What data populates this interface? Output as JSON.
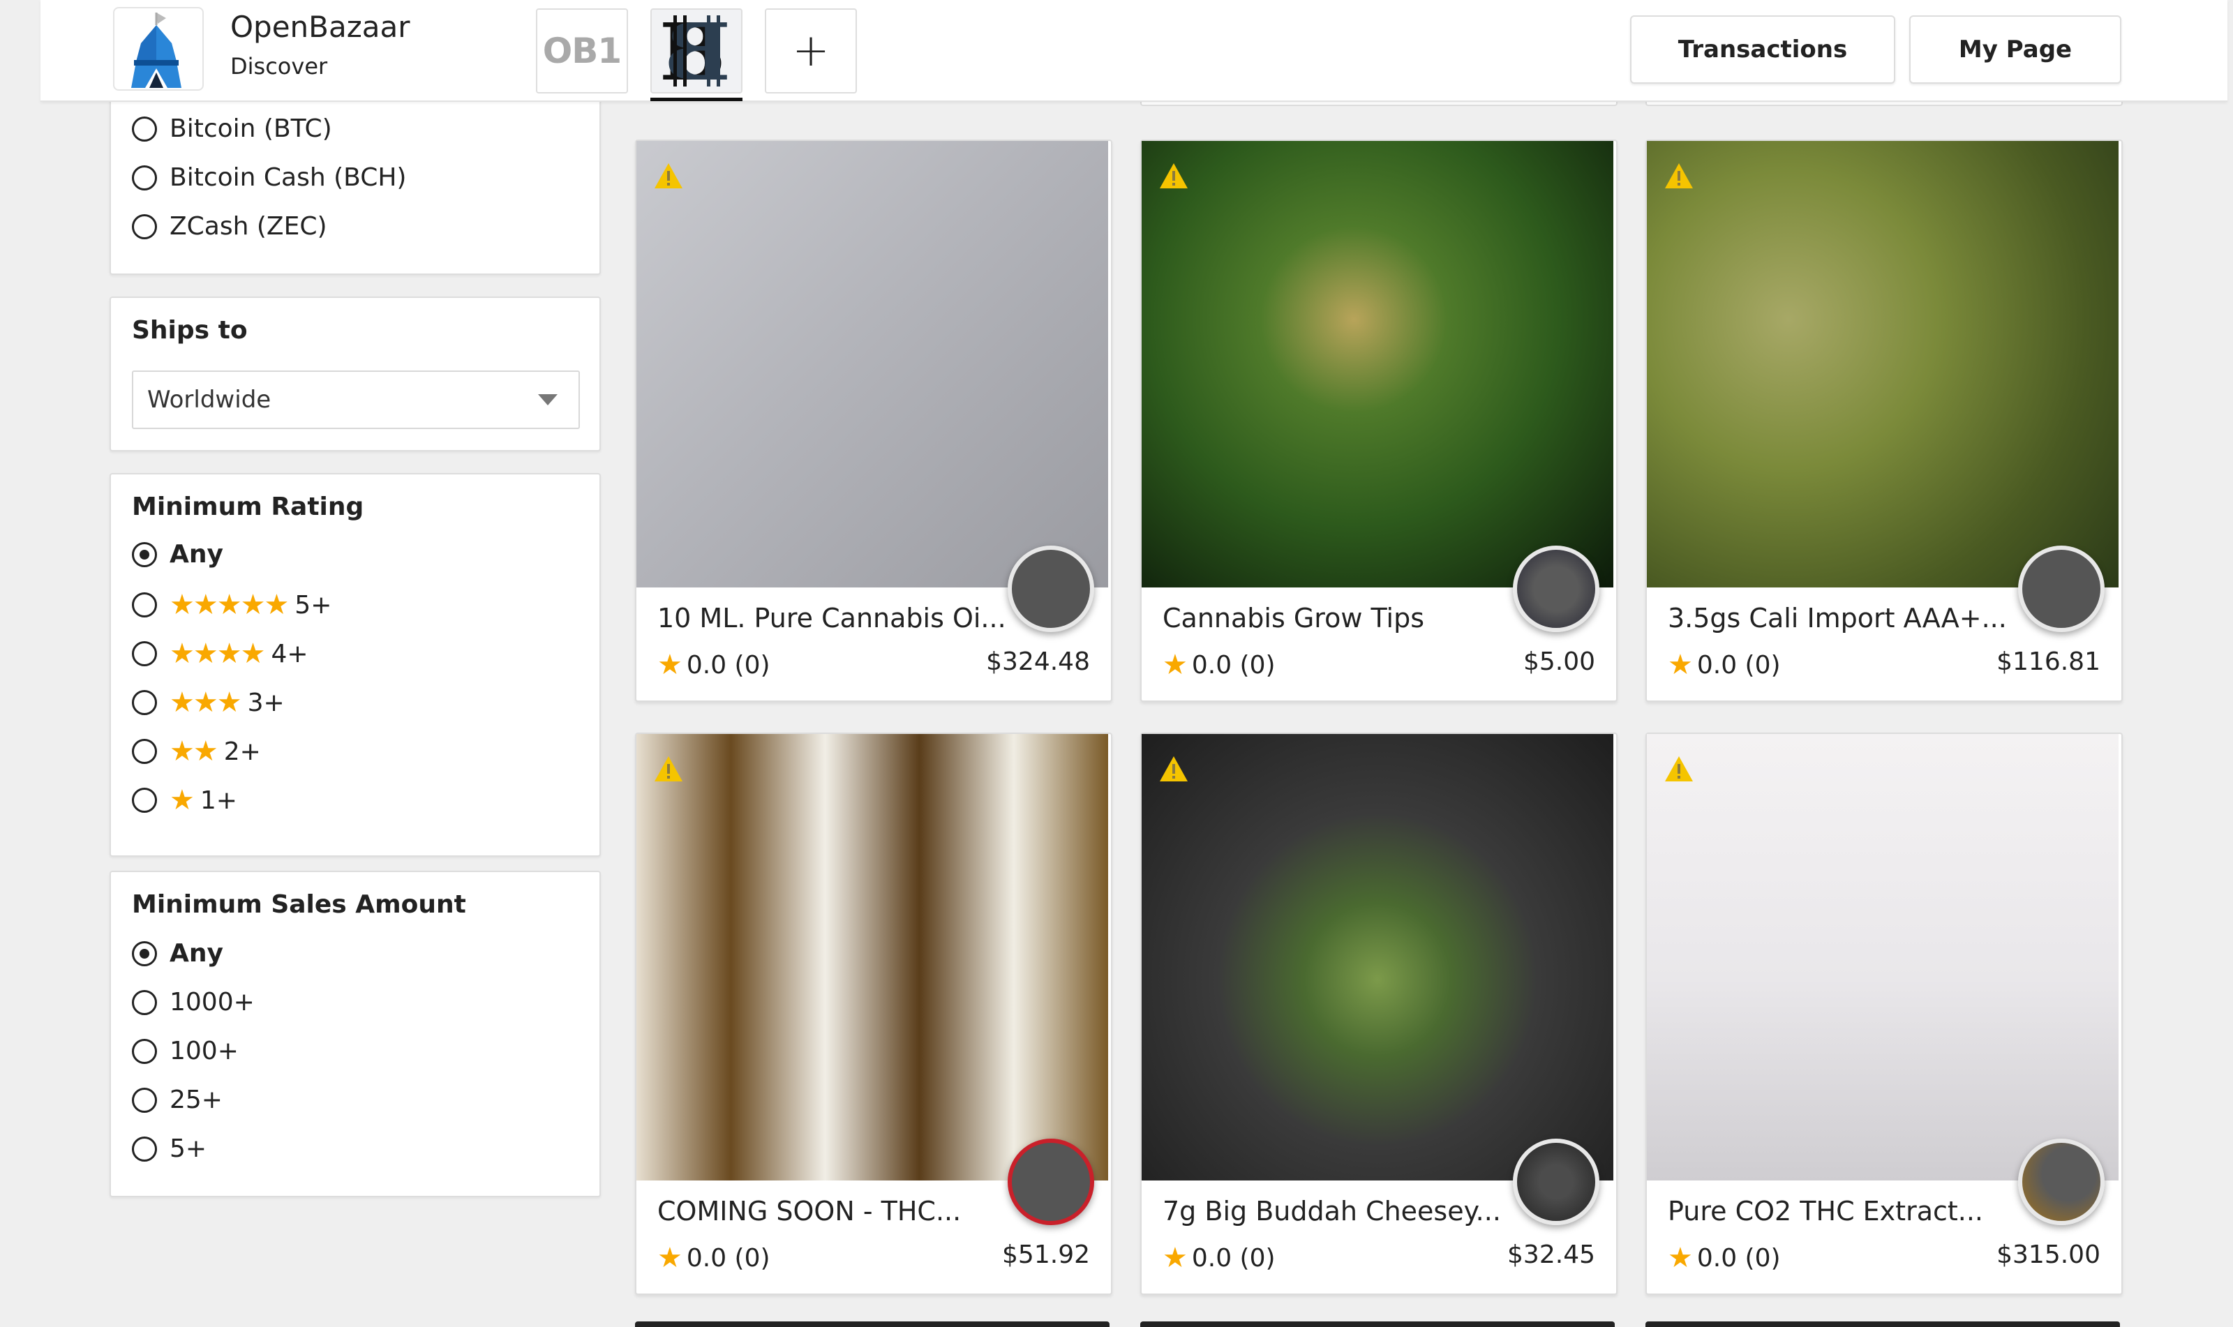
{
  "header": {
    "app_name": "OpenBazaar",
    "app_subtitle": "Discover",
    "tabs": [
      {
        "label": "OB1",
        "icon": "ob1-logo",
        "active": false
      },
      {
        "label": "",
        "icon": "double-bitcoin-logo",
        "active": true
      },
      {
        "label": "+",
        "icon": "plus-icon",
        "active": false
      }
    ],
    "buttons": {
      "transactions": "Transactions",
      "my_page": "My Page"
    }
  },
  "sidebar": {
    "currency": {
      "options": [
        {
          "label": "Bitcoin (BTC)",
          "selected": false
        },
        {
          "label": "Bitcoin Cash (BCH)",
          "selected": false
        },
        {
          "label": "ZCash (ZEC)",
          "selected": false
        }
      ]
    },
    "ships_to": {
      "title": "Ships to",
      "value": "Worldwide"
    },
    "min_rating": {
      "title": "Minimum Rating",
      "options": [
        {
          "label": "Any",
          "stars": "",
          "selected": true
        },
        {
          "label": "5+",
          "stars": "★★★★★",
          "selected": false
        },
        {
          "label": "4+",
          "stars": "★★★★",
          "selected": false
        },
        {
          "label": "3+",
          "stars": "★★★",
          "selected": false
        },
        {
          "label": "2+",
          "stars": "★★",
          "selected": false
        },
        {
          "label": "1+",
          "stars": "★",
          "selected": false
        }
      ]
    },
    "min_sales": {
      "title": "Minimum Sales Amount",
      "options": [
        {
          "label": "Any",
          "selected": true
        },
        {
          "label": "1000+",
          "selected": false
        },
        {
          "label": "100+",
          "selected": false
        },
        {
          "label": "25+",
          "selected": false
        },
        {
          "label": "5+",
          "selected": false
        }
      ]
    }
  },
  "products": [
    {
      "title": "10 ML. Pure Cannabis Oi...",
      "rating": "0.0 (0)",
      "price": "$324.48",
      "warning": true,
      "image": "amber-bottle-with-vape-cartridges",
      "avatar": "qr-code"
    },
    {
      "title": "Cannabis Grow Tips",
      "rating": "0.0 (0)",
      "price": "$5.00",
      "warning": true,
      "image": "cannabis-plant",
      "avatar": "mandala"
    },
    {
      "title": "3.5gs Cali Import AAA+...",
      "rating": "0.0 (0)",
      "price": "$116.81",
      "warning": true,
      "image": "cannabis-buds",
      "avatar": "qr-code"
    },
    {
      "title": "COMING SOON - THC...",
      "rating": "0.0 (0)",
      "price": "$51.92",
      "warning": true,
      "image": "e-liquid-bottles",
      "avatar": "red-badge"
    },
    {
      "title": "7g Big Buddah Cheesey...",
      "rating": "0.0 (0)",
      "price": "$32.45",
      "warning": true,
      "image": "cannabis-bud-on-wood",
      "avatar": "dark-circle"
    },
    {
      "title": "Pure CO2 THC Extract...",
      "rating": "0.0 (0)",
      "price": "$315.00",
      "warning": true,
      "image": "thc-cartridges-bruce-lean",
      "avatar": "person-photo"
    }
  ],
  "colors": {
    "star": "#f9a800",
    "warning": "#f5c400",
    "background": "#efefef"
  }
}
